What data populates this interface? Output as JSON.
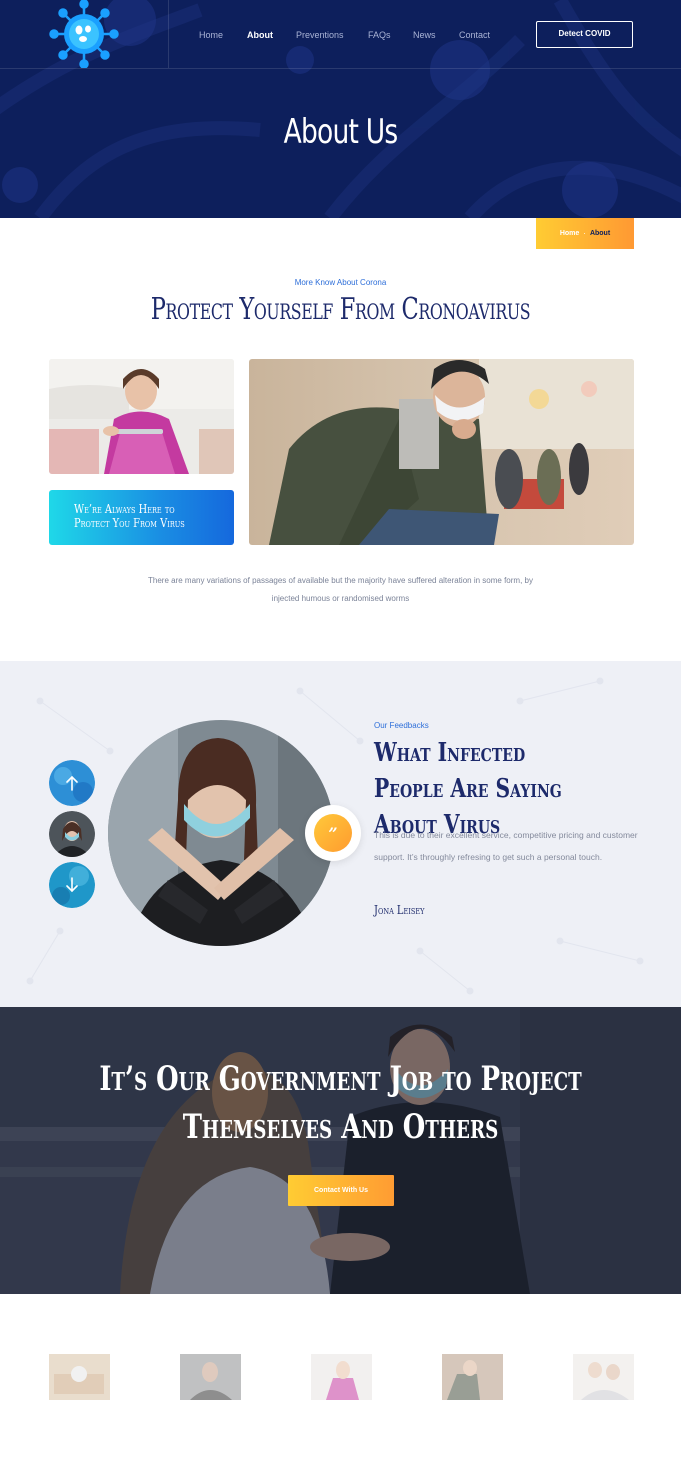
{
  "header": {
    "nav": [
      {
        "label": "Home"
      },
      {
        "label": "About"
      },
      {
        "label": "Preventions"
      },
      {
        "label": "FAQs"
      },
      {
        "label": "News"
      },
      {
        "label": "Contact"
      }
    ],
    "detect_button": "Detect COVID",
    "page_title": "About Us"
  },
  "breadcrumb": {
    "home": "Home",
    "separator": "·",
    "current": "About"
  },
  "about": {
    "kicker": "More Know About Corona",
    "title": "Protect Yourself From Cronoavirus",
    "promo": "We’re Always Here to Protect You From Virus",
    "description": "There are many variations of passages of available but the majority have suffered alteration in some form, by injected humous or randomised worms"
  },
  "feedback": {
    "kicker": "Our Feedbacks",
    "title": "What Infected People Are Saying About Virus",
    "quote_mark": "”",
    "text": "This is due to their excellent service, competitive pricing and customer support. It’s throughly refresing to get such a personal touch.",
    "author": "Jona Leisey"
  },
  "cta": {
    "title": "It’s Our Government Job to Project Themselves And Others",
    "button": "Contact With Us"
  },
  "colors": {
    "navy": "#0d1f5c",
    "accent_blue": "#2e6fd9",
    "orange_start": "#ffcc33",
    "orange_end": "#ff9933",
    "cyan": "#1fd8e8"
  }
}
